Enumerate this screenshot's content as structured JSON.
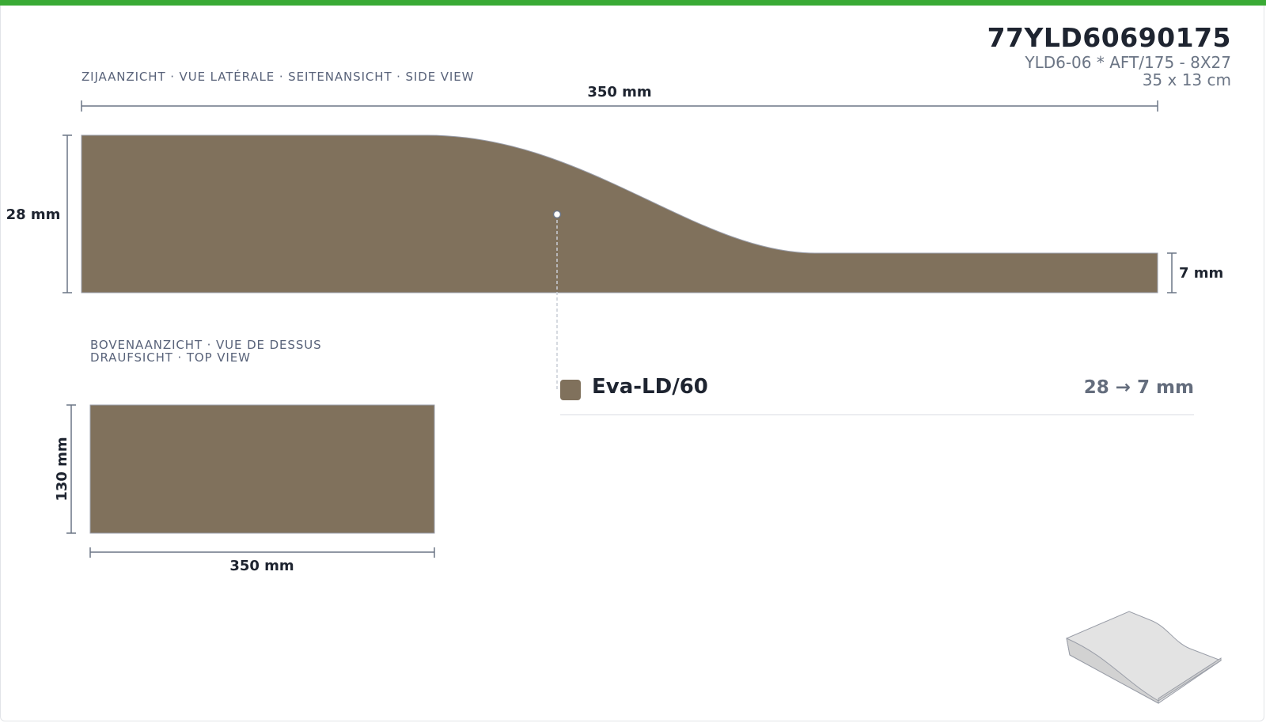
{
  "product": {
    "code": "77YLD60690175",
    "description": "YLD6-06 * AFT/175 - 8X27",
    "size": "35 x 13 cm"
  },
  "side_view": {
    "label": "ZIJAANZICHT · VUE LATÉRALE · SEITENANSICHT · SIDE VIEW",
    "length_label": "350 mm",
    "max_height_label": "28 mm",
    "min_height_label": "7 mm"
  },
  "top_view": {
    "label_line1": "BOVENAANZICHT · VUE DE DESSUS",
    "label_line2": "DRAUFSICHT · TOP VIEW",
    "width_label": "130 mm",
    "length_label": "350 mm"
  },
  "material": {
    "name": "Eva-LD/60",
    "range": "28 → 7 mm",
    "color": "#80715c"
  },
  "colors": {
    "accent_bar": "#3aaa35",
    "dimension_line": "#6b7585",
    "preview_fill": "#e3e3e3"
  }
}
